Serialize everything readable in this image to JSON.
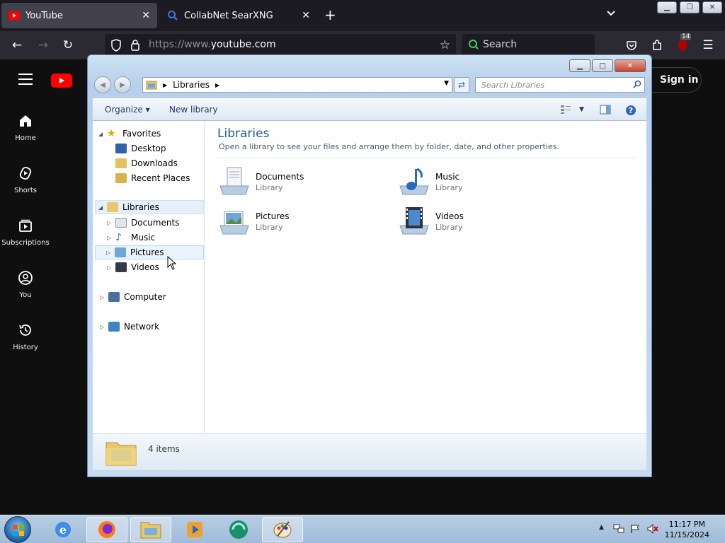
{
  "browser": {
    "tabs": [
      {
        "title": "YouTube",
        "active": true
      },
      {
        "title": "CollabNet SearXNG",
        "active": false
      }
    ],
    "new_tab_symbol": "+",
    "url_prefix": "https://www.",
    "url_domain": "youtube.com",
    "search_placeholder": "Search",
    "extension_badge": "14"
  },
  "youtube": {
    "nav": [
      {
        "label": "Home",
        "icon": "home-icon"
      },
      {
        "label": "Shorts",
        "icon": "shorts-icon"
      },
      {
        "label": "Subscriptions",
        "icon": "subscriptions-icon"
      },
      {
        "label": "You",
        "icon": "you-icon"
      },
      {
        "label": "History",
        "icon": "history-icon"
      }
    ],
    "sign_in": "Sign in",
    "brand_color": "#ff0000"
  },
  "explorer": {
    "breadcrumb": "Libraries",
    "search_placeholder": "Search Libraries",
    "commands": {
      "organize": "Organize",
      "new_library": "New library"
    },
    "tree": {
      "favorites": "Favorites",
      "favorites_items": [
        "Desktop",
        "Downloads",
        "Recent Places"
      ],
      "libraries": "Libraries",
      "libraries_items": [
        "Documents",
        "Music",
        "Pictures",
        "Videos"
      ],
      "computer": "Computer",
      "network": "Network"
    },
    "heading": "Libraries",
    "subheading": "Open a library to see your files and arrange them by folder, date, and other properties.",
    "libraries": [
      {
        "name": "Documents",
        "type": "Library",
        "icon": "documents-library-icon"
      },
      {
        "name": "Music",
        "type": "Library",
        "icon": "music-library-icon"
      },
      {
        "name": "Pictures",
        "type": "Library",
        "icon": "pictures-library-icon"
      },
      {
        "name": "Videos",
        "type": "Library",
        "icon": "videos-library-icon"
      }
    ],
    "status": "4 items"
  },
  "taskbar": {
    "time": "11:17 PM",
    "date": "11/15/2024",
    "apps": [
      "ie-icon",
      "firefox-icon",
      "explorer-icon",
      "media-player-icon",
      "app-icon",
      "paint-icon"
    ]
  }
}
